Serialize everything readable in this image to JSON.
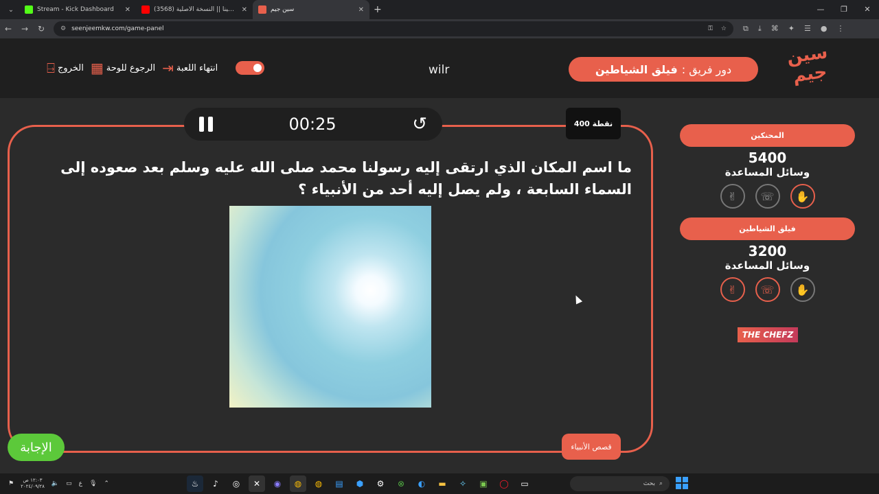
{
  "browser": {
    "tabs": [
      {
        "title": "Stream - Kick Dashboard",
        "favicon_color": "#53fc18",
        "active": false
      },
      {
        "title": "(3568) كنت مينا || النسخة الأصلية",
        "favicon_color": "#ff0000",
        "active": false
      },
      {
        "title": "سين جيم",
        "favicon_color": "#e8604c",
        "active": true
      }
    ],
    "new_tab": "+",
    "url": "seenjeemkw.com/game-panel"
  },
  "header": {
    "logo_text": "سين جيم",
    "turn_label": "دور فريق :",
    "turn_team": "فيلق الشياطين",
    "streamer": "wilr",
    "end_game_label": "انتهاء اللعبة",
    "back_to_board_label": "الرجوع للوحة",
    "exit_label": "الخروج"
  },
  "question_panel": {
    "timer": "00:25",
    "points": "400 نقطة",
    "question": "ما اسم المكان الذي ارتقى إليه رسولنا محمد صلى الله عليه وسلم بعد صعوده إلى السماء السابعة ، ولم يصل إليه أحد من الأنبياء ؟",
    "category": "قصص الأنبياء",
    "answer_button": "الإجابة"
  },
  "teams": [
    {
      "name": "المحنكين",
      "score": "5400",
      "aids_label": "وسائل المساعدة",
      "aids": [
        {
          "icon": "two-fingers-icon",
          "active": false
        },
        {
          "icon": "phone-icon",
          "active": false
        },
        {
          "icon": "hand-icon",
          "active": true
        }
      ]
    },
    {
      "name": "فيلق الشياطين",
      "score": "3200",
      "aids_label": "وسائل المساعدة",
      "aids": [
        {
          "icon": "two-fingers-icon",
          "active": true
        },
        {
          "icon": "phone-icon",
          "active": true
        },
        {
          "icon": "hand-icon",
          "active": false
        }
      ]
    }
  ],
  "sponsor": "THE CHEFZ",
  "taskbar": {
    "time": "١٢:٠٣ ص",
    "date": "٢٠٢٤/٠٩/٢٨",
    "lang": "ع",
    "search_label": "بحث"
  },
  "colors": {
    "accent": "#e8604c",
    "answer": "#5cc93a",
    "bg": "#2b2b2b",
    "header": "#1f1f1f"
  }
}
